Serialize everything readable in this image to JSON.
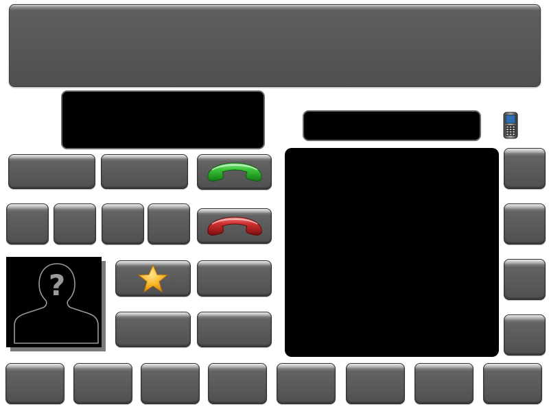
{
  "app": {
    "top_status_text": "",
    "number_display": "",
    "caller_display": "",
    "colors": {
      "button_face": "#5a5a5a",
      "display_bg": "#000000",
      "call_green": "#2fb52f",
      "hangup_red": "#c0201f",
      "favorite_gold": "#f5a623"
    }
  },
  "buttons": {
    "row1": [
      "",
      ""
    ],
    "row2": [
      "",
      "",
      "",
      ""
    ],
    "middle": [
      "",
      "",
      ""
    ],
    "right_column": [
      "",
      "",
      "",
      ""
    ],
    "bottom_row": [
      "",
      "",
      "",
      "",
      "",
      "",
      "",
      ""
    ]
  },
  "icons": {
    "call": "phone-answer-icon",
    "hangup": "phone-hangup-icon",
    "favorite": "star-icon",
    "device": "mobile-phone-icon",
    "contact": "unknown-contact-icon"
  }
}
